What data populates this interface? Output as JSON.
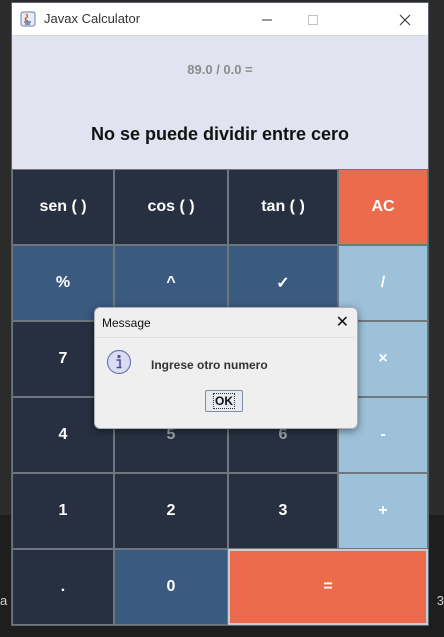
{
  "window": {
    "title": "Javax Calculator",
    "minimize_icon": "minimize-icon",
    "maximize_icon": "maximize-icon",
    "close_icon": "close-icon"
  },
  "display": {
    "expression": "89.0 / 0.0 =",
    "result": "No se puede dividir entre cero"
  },
  "keys": {
    "sen": "sen ( )",
    "cos": "cos ( )",
    "tan": "tan ( )",
    "ac": "AC",
    "percent": "%",
    "power": "^",
    "sqrt": "✓",
    "divide": "/",
    "seven": "7",
    "multiply": "×",
    "four": "4",
    "five": "5",
    "six": "6",
    "minus": "-",
    "one": "1",
    "two": "2",
    "three": "3",
    "plus": "+",
    "dot": ".",
    "zero": "0",
    "equals": "="
  },
  "dialog": {
    "title": "Message",
    "close_glyph": "✕",
    "message": "Ingrese otro numero",
    "ok_label": "OK",
    "icon": "info-icon"
  },
  "background": {
    "left_text": "a",
    "right_text": "3"
  },
  "colors": {
    "dark_key": "#263040",
    "blue_key": "#3b5a80",
    "light_key": "#9cc1d9",
    "orange_key": "#ed6b4d",
    "display_bg": "#e2e3f1"
  }
}
